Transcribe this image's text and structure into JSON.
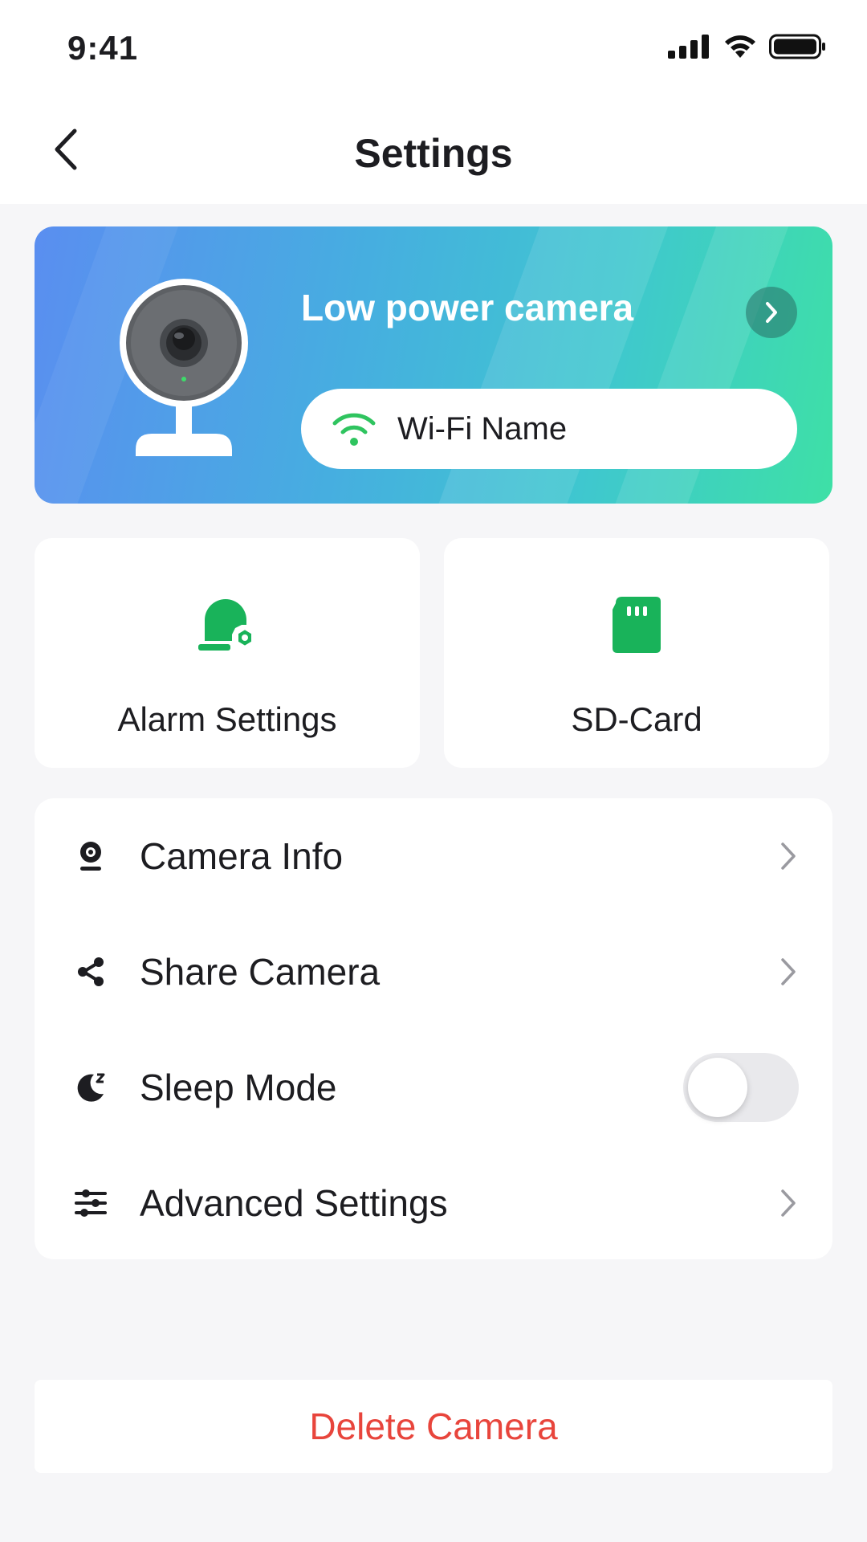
{
  "status_bar": {
    "time": "9:41",
    "icons": [
      "signal-icon",
      "wifi-icon",
      "battery-icon"
    ]
  },
  "header": {
    "title": "Settings",
    "back_icon": "chevron-left-icon"
  },
  "device_card": {
    "name": "Low power camera",
    "wifi_name": "Wi-Fi Name",
    "wifi_icon_color": "#2fc45f",
    "gradient_colors": [
      "#5a8ef0",
      "#3ee0a6"
    ]
  },
  "quick_actions": [
    {
      "label": "Alarm Settings",
      "icon": "alarm-siren-icon"
    },
    {
      "label": "SD-Card",
      "icon": "sd-card-icon"
    }
  ],
  "accent_color": "#19b35a",
  "settings_list": [
    {
      "label": "Camera Info",
      "icon": "webcam-icon",
      "control": "chevron"
    },
    {
      "label": "Share Camera",
      "icon": "share-icon",
      "control": "chevron"
    },
    {
      "label": "Sleep Mode",
      "icon": "moon-sleep-icon",
      "control": "toggle",
      "toggle_on": false
    },
    {
      "label": "Advanced Settings",
      "icon": "sliders-icon",
      "control": "chevron"
    }
  ],
  "delete": {
    "label": "Delete Camera",
    "color": "#e8453c"
  }
}
